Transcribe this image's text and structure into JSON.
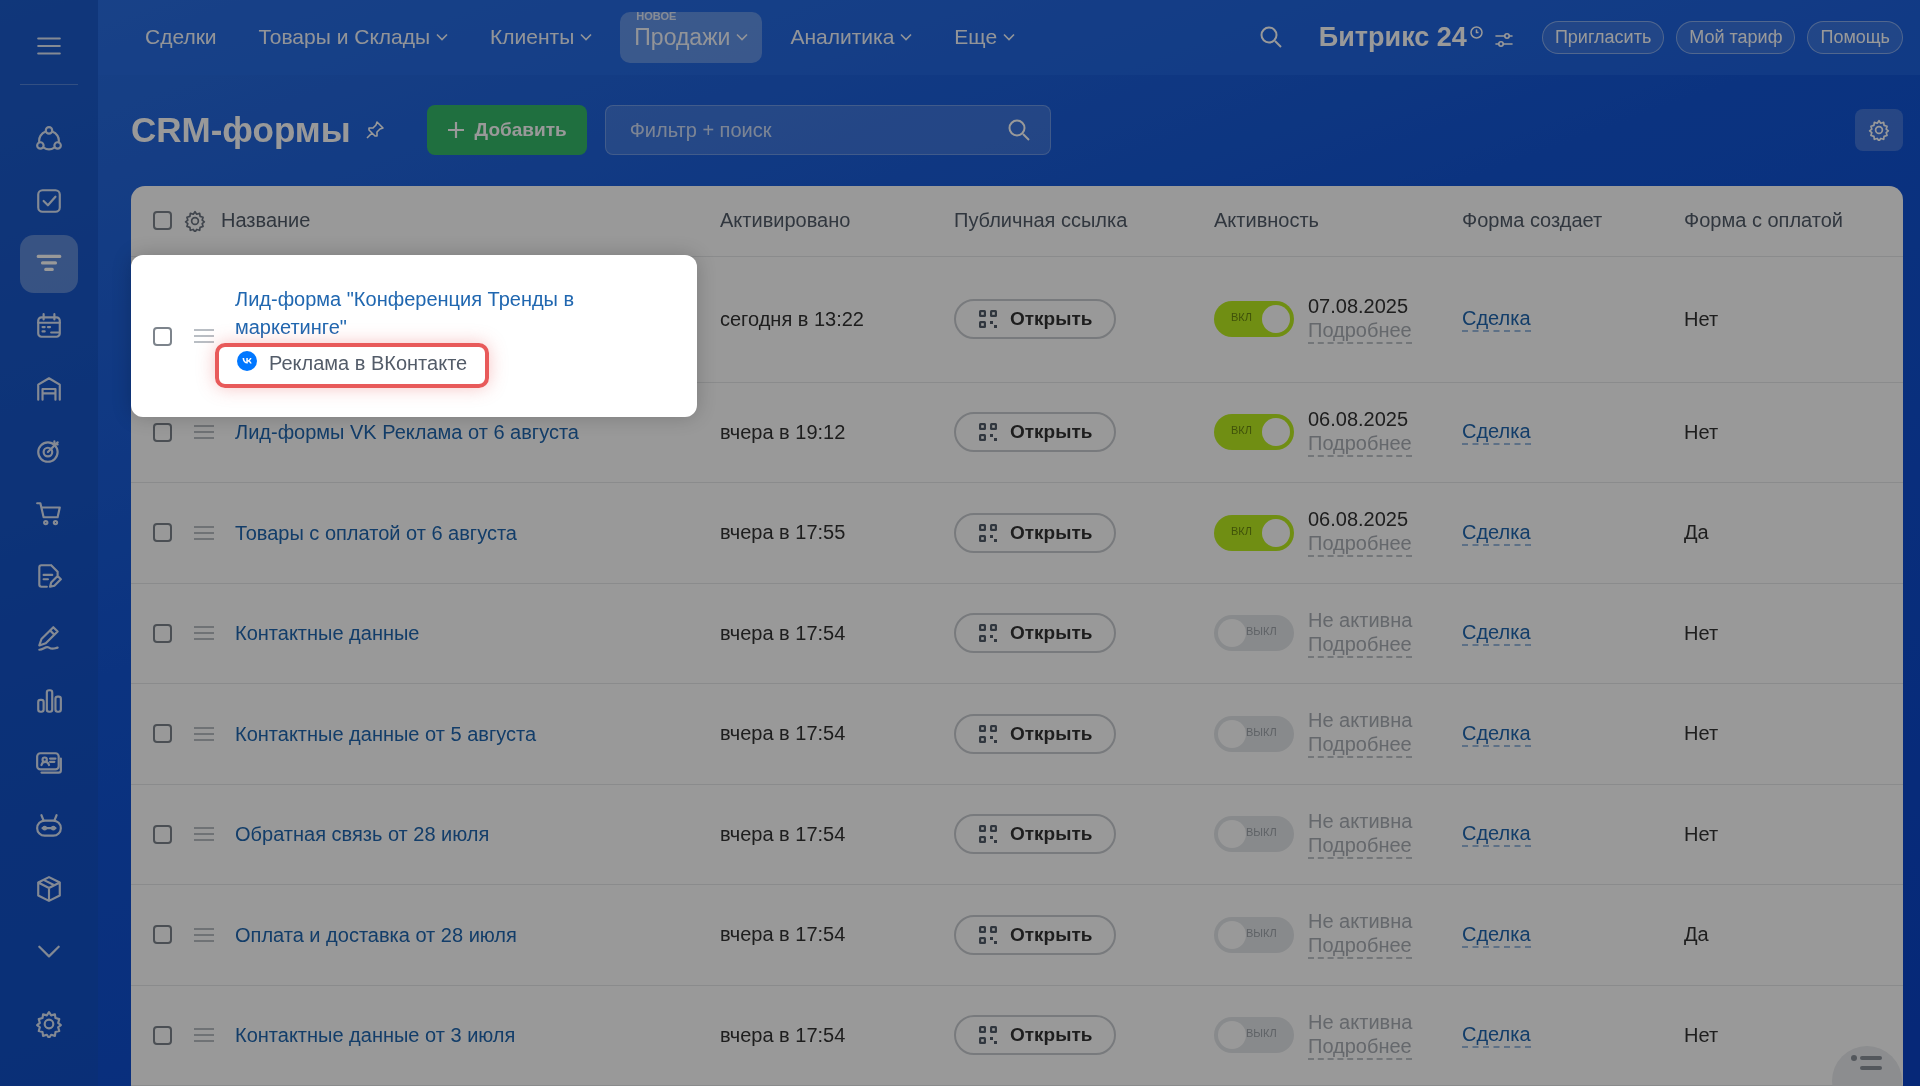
{
  "sidebar": {
    "items": [
      {
        "kind": "menu",
        "selected": false
      },
      {
        "kind": "nodes",
        "selected": false
      },
      {
        "kind": "task",
        "selected": false
      },
      {
        "kind": "funnel",
        "selected": true
      },
      {
        "kind": "calendar",
        "selected": false
      },
      {
        "kind": "store",
        "selected": false
      },
      {
        "kind": "target",
        "selected": false
      },
      {
        "kind": "cart",
        "selected": false
      },
      {
        "kind": "document",
        "selected": false
      },
      {
        "kind": "pen",
        "selected": false
      },
      {
        "kind": "chart",
        "selected": false
      },
      {
        "kind": "card",
        "selected": false
      },
      {
        "kind": "robot",
        "selected": false
      },
      {
        "kind": "box",
        "selected": false
      },
      {
        "kind": "chevron",
        "selected": false
      },
      {
        "kind": "settings",
        "selected": false
      }
    ]
  },
  "top_nav": {
    "items": [
      {
        "label": "Сделки",
        "dropdown": false,
        "selected": false
      },
      {
        "label": "Товары и Склады",
        "dropdown": true,
        "selected": false
      },
      {
        "label": "Клиенты",
        "dropdown": true,
        "selected": false
      },
      {
        "label": "Продажи",
        "dropdown": true,
        "selected": true,
        "badge": "НОВОЕ"
      },
      {
        "label": "Аналитика",
        "dropdown": true,
        "selected": false
      },
      {
        "label": "Еще",
        "dropdown": true,
        "selected": false
      }
    ],
    "logo": {
      "name": "Битрикс",
      "suffix": "24"
    },
    "buttons": [
      "Пригласить",
      "Мой тариф",
      "Помощь"
    ]
  },
  "header": {
    "title": "CRM-формы",
    "add_button": "Добавить",
    "search": {
      "placeholder": "Фильтр + поиск"
    }
  },
  "table": {
    "header_checked": false,
    "columns": [
      "Название",
      "Активировано",
      "Публичная ссылка",
      "Активность",
      "Форма создает",
      "Форма с оплатой"
    ],
    "rows": [
      {
        "name": "Лид-форма \"Конференция Тренды в маркетинге\"",
        "spotlight": true,
        "source": {
          "text": "Реклама в ВКонтакте",
          "highlighted": true
        },
        "activated": "сегодня в 13:22",
        "link_button": "Открыть",
        "on": true,
        "toggle_label": "ВКЛ",
        "status": "07.08.2025",
        "details": "Подробнее",
        "creates": "Сделка",
        "payment": "Нет",
        "checked": false
      },
      {
        "name": "Лид-формы VK Реклама от 6 августа",
        "spotlight": false,
        "activated": "вчера в 19:12",
        "link_button": "Открыть",
        "on": true,
        "toggle_label": "ВКЛ",
        "status": "06.08.2025",
        "details": "Подробнее",
        "creates": "Сделка",
        "payment": "Нет",
        "checked": false
      },
      {
        "name": "Товары с оплатой от 6 августа",
        "spotlight": false,
        "activated": "вчера в 17:55",
        "link_button": "Открыть",
        "on": true,
        "toggle_label": "ВКЛ",
        "status": "06.08.2025",
        "details": "Подробнее",
        "creates": "Сделка",
        "payment": "Да",
        "checked": false
      },
      {
        "name": "Контактные данные",
        "spotlight": false,
        "activated": "вчера в 17:54",
        "link_button": "Открыть",
        "on": false,
        "toggle_label": "ВЫКЛ",
        "status": "Не активна",
        "details": "Подробнее",
        "creates": "Сделка",
        "payment": "Нет",
        "checked": false
      },
      {
        "name": "Контактные данные от 5 августа",
        "spotlight": false,
        "activated": "вчера в 17:54",
        "link_button": "Открыть",
        "on": false,
        "toggle_label": "ВЫКЛ",
        "status": "Не активна",
        "details": "Подробнее",
        "creates": "Сделка",
        "payment": "Нет",
        "checked": false
      },
      {
        "name": "Обратная связь от 28 июля",
        "spotlight": false,
        "activated": "вчера в 17:54",
        "link_button": "Открыть",
        "on": false,
        "toggle_label": "ВЫКЛ",
        "status": "Не активна",
        "details": "Подробнее",
        "creates": "Сделка",
        "payment": "Нет",
        "checked": false
      },
      {
        "name": "Оплата и доставка от 28 июля",
        "spotlight": false,
        "activated": "вчера в 17:54",
        "link_button": "Открыть",
        "on": false,
        "toggle_label": "ВЫКЛ",
        "status": "Не активна",
        "details": "Подробнее",
        "creates": "Сделка",
        "payment": "Да",
        "checked": false
      },
      {
        "name": "Контактные данные от 3 июля",
        "spotlight": false,
        "activated": "вчера в 17:54",
        "link_button": "Открыть",
        "on": false,
        "toggle_label": "ВЫКЛ",
        "status": "Не активна",
        "details": "Подробнее",
        "creates": "Сделка",
        "payment": "Нет",
        "checked": false
      }
    ]
  }
}
